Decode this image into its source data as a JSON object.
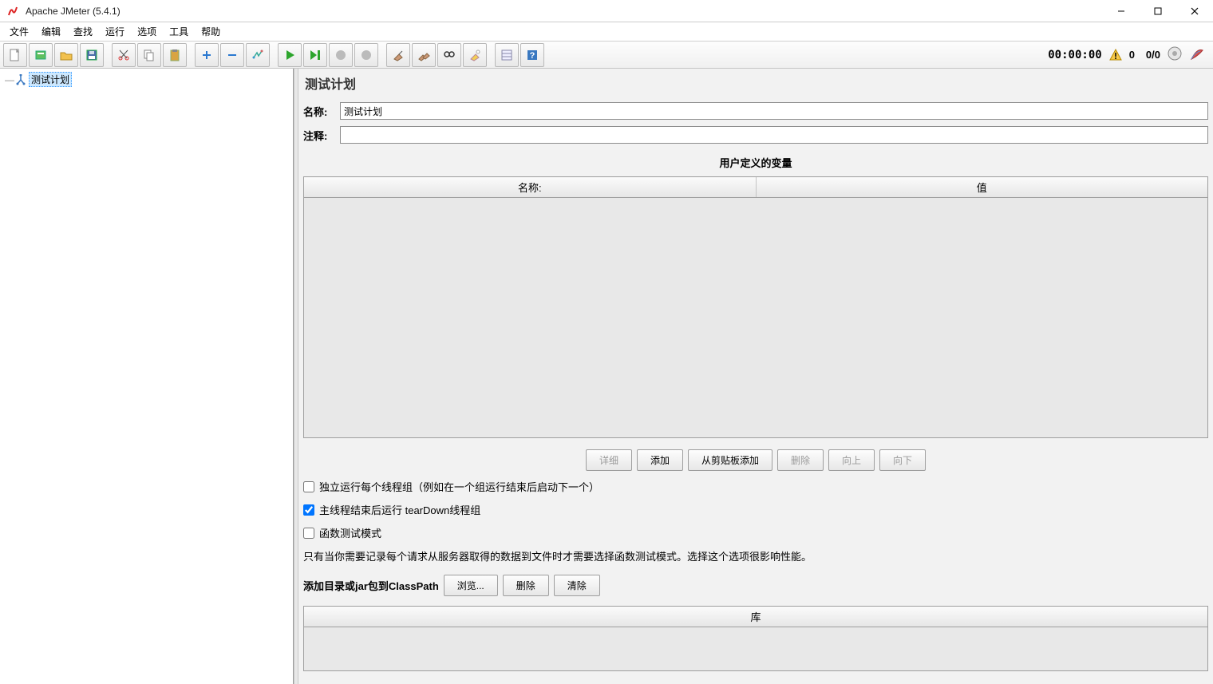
{
  "window": {
    "title": "Apache JMeter (5.4.1)"
  },
  "menu": {
    "file": "文件",
    "edit": "编辑",
    "search": "查找",
    "run": "运行",
    "options": "选项",
    "tools": "工具",
    "help": "帮助"
  },
  "toolbar_status": {
    "timer": "00:00:00",
    "warn_count": "0",
    "thread_ratio": "0/0"
  },
  "tree": {
    "root_label": "测试计划"
  },
  "panel": {
    "title": "测试计划",
    "name_label": "名称:",
    "name_value": "测试计划",
    "comment_label": "注释:",
    "comment_value": "",
    "vars_section": "用户定义的变量",
    "vars_col_name": "名称:",
    "vars_col_value": "值",
    "btn_detail": "详细",
    "btn_add": "添加",
    "btn_clip": "从剪贴板添加",
    "btn_delete": "删除",
    "btn_up": "向上",
    "btn_down": "向下",
    "cb_serial": "独立运行每个线程组（例如在一个组运行结束后启动下一个）",
    "cb_teardown": "主线程结束后运行 tearDown线程组",
    "cb_func": "函数测试模式",
    "note": "只有当你需要记录每个请求从服务器取得的数据到文件时才需要选择函数测试模式。选择这个选项很影响性能。",
    "cp_label": "添加目录或jar包到ClassPath",
    "cp_browse": "浏览...",
    "cp_delete": "删除",
    "cp_clear": "清除",
    "lib_header": "库"
  }
}
